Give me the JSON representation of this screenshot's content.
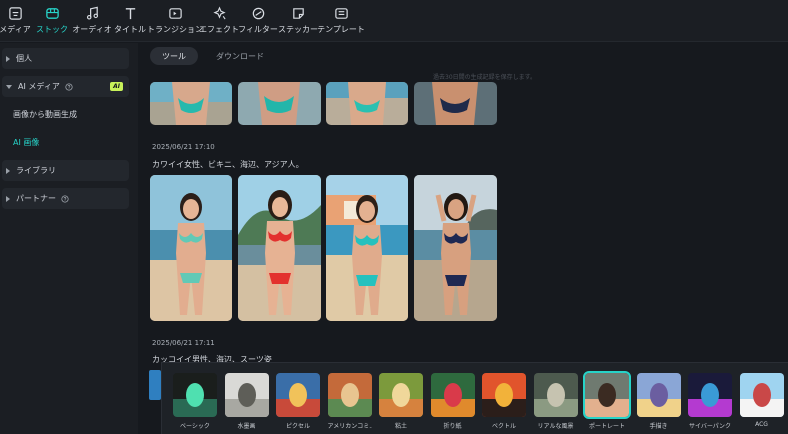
{
  "toolbar": [
    {
      "label": "メディア",
      "icon": "media-icon"
    },
    {
      "label": "ストック",
      "icon": "stock-icon",
      "active": true
    },
    {
      "label": "オーディオ",
      "icon": "audio-icon"
    },
    {
      "label": "タイトル",
      "icon": "title-icon"
    },
    {
      "label": "トランジション",
      "icon": "transition-icon"
    },
    {
      "label": "エフェクト",
      "icon": "effect-icon"
    },
    {
      "label": "フィルター",
      "icon": "filter-icon"
    },
    {
      "label": "ステッカー",
      "icon": "sticker-icon"
    },
    {
      "label": "テンプレート",
      "icon": "template-icon"
    }
  ],
  "sidebar": {
    "personal": "個人",
    "ai_media": "AI メディア",
    "ai_badge": "AI",
    "sub_image_to_video": "画像から動画生成",
    "sub_ai_image": "AI 画像",
    "library": "ライブラリ",
    "partner": "パートナー"
  },
  "main": {
    "tabs": [
      {
        "label": "ツール",
        "active": true
      },
      {
        "label": "ダウンロード",
        "active": false
      }
    ],
    "notice": "過去30日間の生成記録を保存します。",
    "entries": [
      {
        "date": "2025/06/21 17:10",
        "prompt": "カワイイ女性、ビキニ、海辺、アジア人。"
      },
      {
        "date": "2025/06/21 17:11",
        "prompt": "カッコイイ男性、海辺、スーツ姿"
      }
    ]
  },
  "styles": [
    {
      "label": "ベーシック"
    },
    {
      "label": "水墨画"
    },
    {
      "label": "ピクセル"
    },
    {
      "label": "アメリカンコミ..."
    },
    {
      "label": "粘土"
    },
    {
      "label": "折り紙"
    },
    {
      "label": "ベクトル"
    },
    {
      "label": "リアルな風景"
    },
    {
      "label": "ポートレート",
      "selected": true
    },
    {
      "label": "手描き"
    },
    {
      "label": "サイバーパンク"
    },
    {
      "label": "ACG"
    }
  ],
  "colors": {
    "accent": "#27d3c8",
    "ai_badge": "#c8f25a"
  }
}
